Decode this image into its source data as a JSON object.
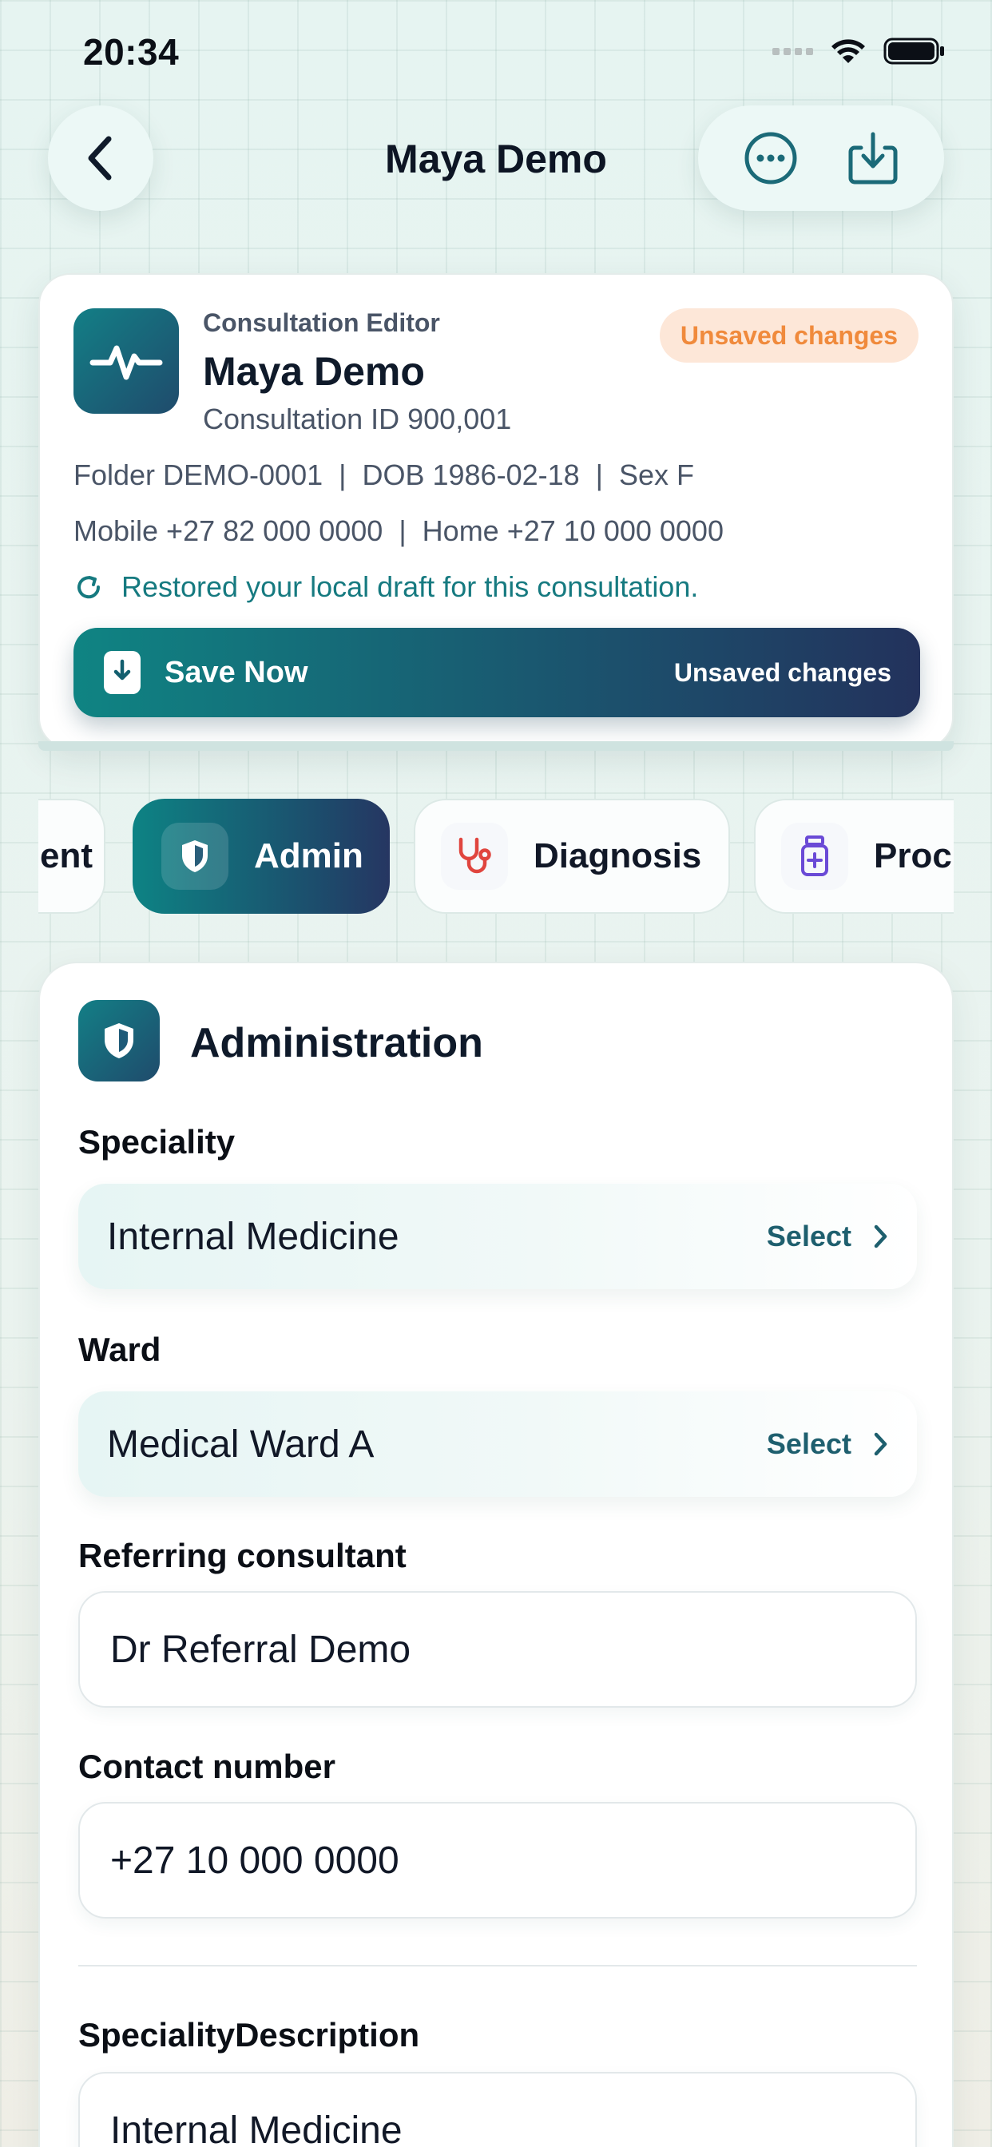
{
  "status_bar": {
    "time": "20:34"
  },
  "nav": {
    "title": "Maya Demo"
  },
  "header": {
    "eyebrow": "Consultation Editor",
    "patient_name": "Maya Demo",
    "consultation_id": "Consultation ID 900,001",
    "badge": "Unsaved changes",
    "meta_line_1": "Folder DEMO-0001  |  DOB 1986-02-18  |  Sex F",
    "meta_line_2": "Mobile +27 82 000 0000  |  Home +27 10 000 0000",
    "restored_message": "Restored your local draft for this consultation.",
    "save_label": "Save Now",
    "save_status": "Unsaved changes"
  },
  "tabs": [
    {
      "label": "ent",
      "icon": "partial-tab"
    },
    {
      "label": "Admin",
      "icon": "shield-icon",
      "active": true
    },
    {
      "label": "Diagnosis",
      "icon": "stethoscope-icon"
    },
    {
      "label": "Proc",
      "icon": "medicine-bottle-icon"
    }
  ],
  "admin": {
    "title": "Administration",
    "speciality_label": "Speciality",
    "speciality_value": "Internal Medicine",
    "ward_label": "Ward",
    "ward_value": "Medical Ward A",
    "select_label": "Select",
    "referring_label": "Referring consultant",
    "referring_value": "Dr Referral Demo",
    "contact_label": "Contact number",
    "contact_value": "+27 10 000 0000",
    "speciality_desc_label": "SpecialityDescription",
    "speciality_desc_value": "Internal Medicine"
  },
  "colors": {
    "accent_teal": "#0f8483",
    "accent_navy": "#23325c",
    "badge_bg": "#fde7d8",
    "badge_text": "#f08a3c",
    "diagnosis_icon": "#e0453e",
    "proc_icon": "#6a4ad6"
  }
}
